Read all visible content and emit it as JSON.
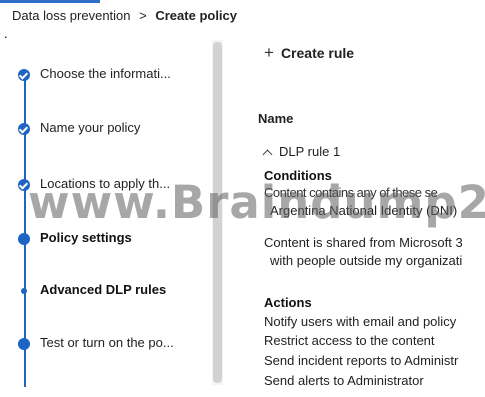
{
  "breadcrumb": {
    "parent": "Data loss prevention",
    "separator": ">",
    "current": "Create policy"
  },
  "stray_mark": ".",
  "wizard": {
    "steps": [
      {
        "label": "Choose the informati...",
        "state": "completed",
        "icon": "check-icon"
      },
      {
        "label": "Name your policy",
        "state": "completed",
        "icon": "check-icon"
      },
      {
        "label": "Locations to apply th...",
        "state": "completed",
        "icon": "check-icon"
      },
      {
        "label": "Policy settings",
        "state": "current",
        "icon": "dot-icon"
      },
      {
        "label": "Advanced DLP rules",
        "state": "current-substep",
        "icon": "small-dot-icon"
      },
      {
        "label": "Test or turn on the po...",
        "state": "upcoming",
        "icon": "dot-icon"
      }
    ]
  },
  "main": {
    "create_rule_label": "Create rule",
    "column_header": "Name",
    "rule": {
      "name": "DLP rule 1",
      "conditions_title": "Conditions",
      "conditions": [
        "Content contains any of these se",
        "Argentina National Identity (DNI)",
        "Content is shared from Microsoft 3",
        "with people outside my organizati"
      ],
      "actions_title": "Actions",
      "actions": [
        "Notify users with email and policy",
        "Restrict access to the content",
        "Send incident reports to Administr",
        "Send alerts to Administrator"
      ]
    }
  },
  "watermark": "www.Braindump2",
  "colors": {
    "accent": "#1d64c4",
    "text": "#222222",
    "watermark": "#5f5f5f"
  }
}
